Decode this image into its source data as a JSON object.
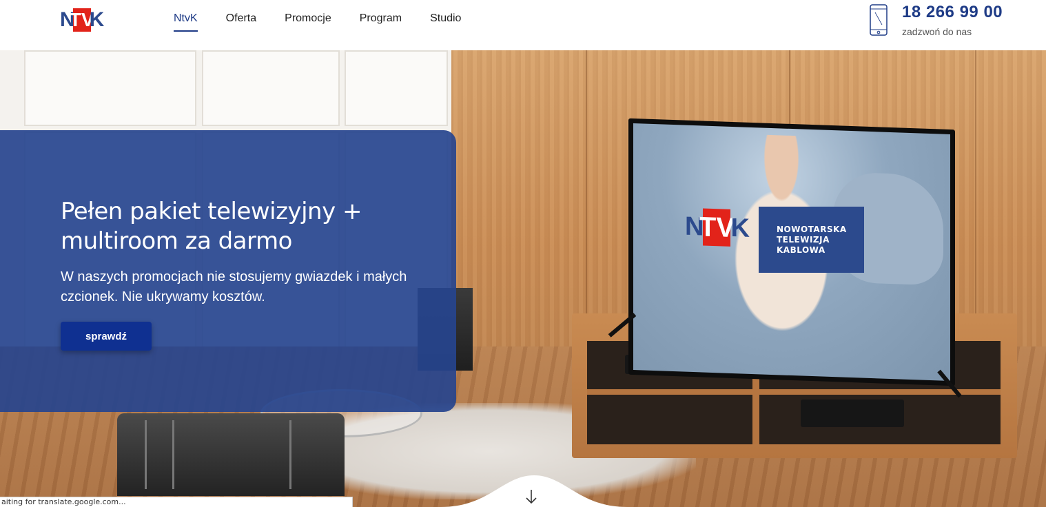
{
  "brand": {
    "logo_left": "N",
    "logo_box": "TV",
    "logo_right": "K"
  },
  "nav": {
    "items": [
      {
        "label": "NtvK",
        "active": true
      },
      {
        "label": "Oferta",
        "active": false
      },
      {
        "label": "Promocje",
        "active": false
      },
      {
        "label": "Program",
        "active": false
      },
      {
        "label": "Studio",
        "active": false
      }
    ]
  },
  "contact": {
    "phone": "18 266 99 00",
    "caption": "zadzwoń do nas",
    "icon": "smartphone-icon"
  },
  "hero": {
    "title": "Pełen pakiet telewizyjny + multiroom za darmo",
    "text": "W naszych promocjach nie stosujemy gwiazdek i małych czcionek. Nie ukrywamy kosztów.",
    "button_label": "sprawdź",
    "scroll_icon": "arrow-down-icon"
  },
  "tv_screen": {
    "logo_left": "N",
    "logo_box": "TV",
    "logo_right": "K",
    "panel_lines": [
      "NOWOTARSKA",
      "TELEWIZJA",
      "KABLOWA"
    ]
  },
  "browser": {
    "status_text": "aiting for translate.google.com..."
  },
  "colors": {
    "brand_blue": "#1e3b86",
    "brand_red": "#e2231a",
    "card_blue": "#26448e",
    "button_blue": "#0f3091"
  }
}
